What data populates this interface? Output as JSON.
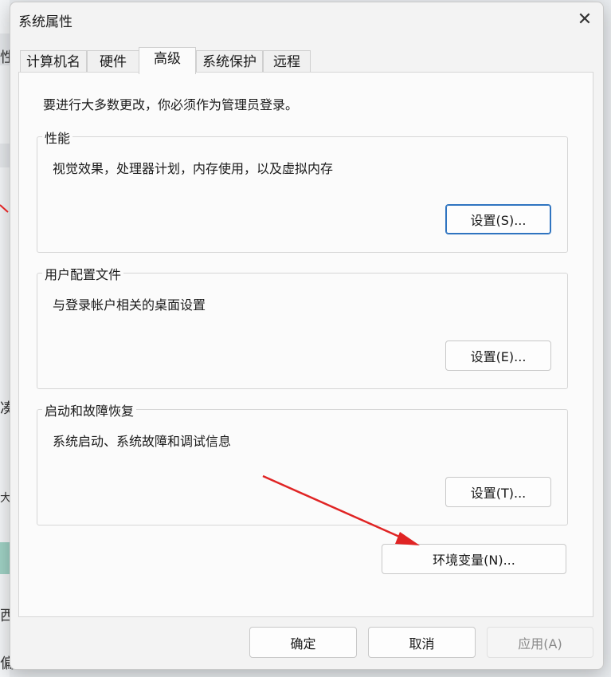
{
  "background": {
    "fragments": [
      "性",
      "凑",
      "大",
      "西",
      "偏"
    ]
  },
  "dialog": {
    "title": "系统属性",
    "close_glyph": "✕",
    "tabs": [
      {
        "label": "计算机名",
        "active": false
      },
      {
        "label": "硬件",
        "active": false
      },
      {
        "label": "高级",
        "active": true
      },
      {
        "label": "系统保护",
        "active": false
      },
      {
        "label": "远程",
        "active": false
      }
    ],
    "notice": "要进行大多数更改，你必须作为管理员登录。",
    "groups": [
      {
        "label": "性能",
        "desc": "视觉效果，处理器计划，内存使用，以及虚拟内存",
        "button": "设置(S)..."
      },
      {
        "label": "用户配置文件",
        "desc": "与登录帐户相关的桌面设置",
        "button": "设置(E)..."
      },
      {
        "label": "启动和故障恢复",
        "desc": "系统启动、系统故障和调试信息",
        "button": "设置(T)..."
      }
    ],
    "env_button": "环境变量(N)...",
    "footer": {
      "ok": "确定",
      "cancel": "取消",
      "apply": "应用(A)"
    }
  },
  "colors": {
    "annotation_arrow": "#e02424",
    "focus_border": "#2f74c0"
  }
}
